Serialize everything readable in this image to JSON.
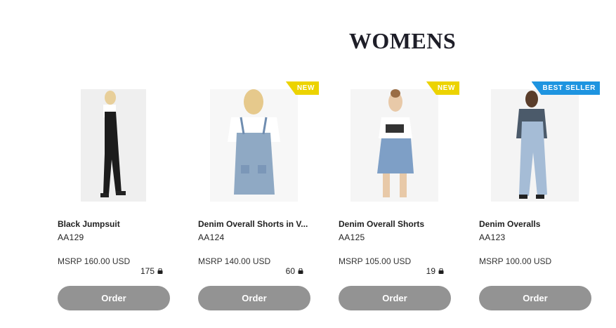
{
  "section": {
    "title": "WOMENS"
  },
  "colors": {
    "new_badge": "#ecd300",
    "best_seller_badge": "#1e94e0",
    "order_button": "#939393"
  },
  "products": [
    {
      "name": "Black Jumpsuit",
      "sku": "AA129",
      "msrp": "MSRP 160.00 USD",
      "stock": "175",
      "badge": "",
      "order_label": "Order"
    },
    {
      "name": "Denim Overall Shorts in V...",
      "sku": "AA124",
      "msrp": "MSRP 140.00 USD",
      "stock": "60",
      "badge": "NEW",
      "order_label": "Order"
    },
    {
      "name": "Denim Overall Shorts",
      "sku": "AA125",
      "msrp": "MSRP 105.00 USD",
      "stock": "19",
      "badge": "NEW",
      "order_label": "Order"
    },
    {
      "name": "Denim Overalls",
      "sku": "AA123",
      "msrp": "MSRP 100.00 USD",
      "stock": "",
      "badge": "BEST SELLER",
      "order_label": "Order"
    }
  ]
}
